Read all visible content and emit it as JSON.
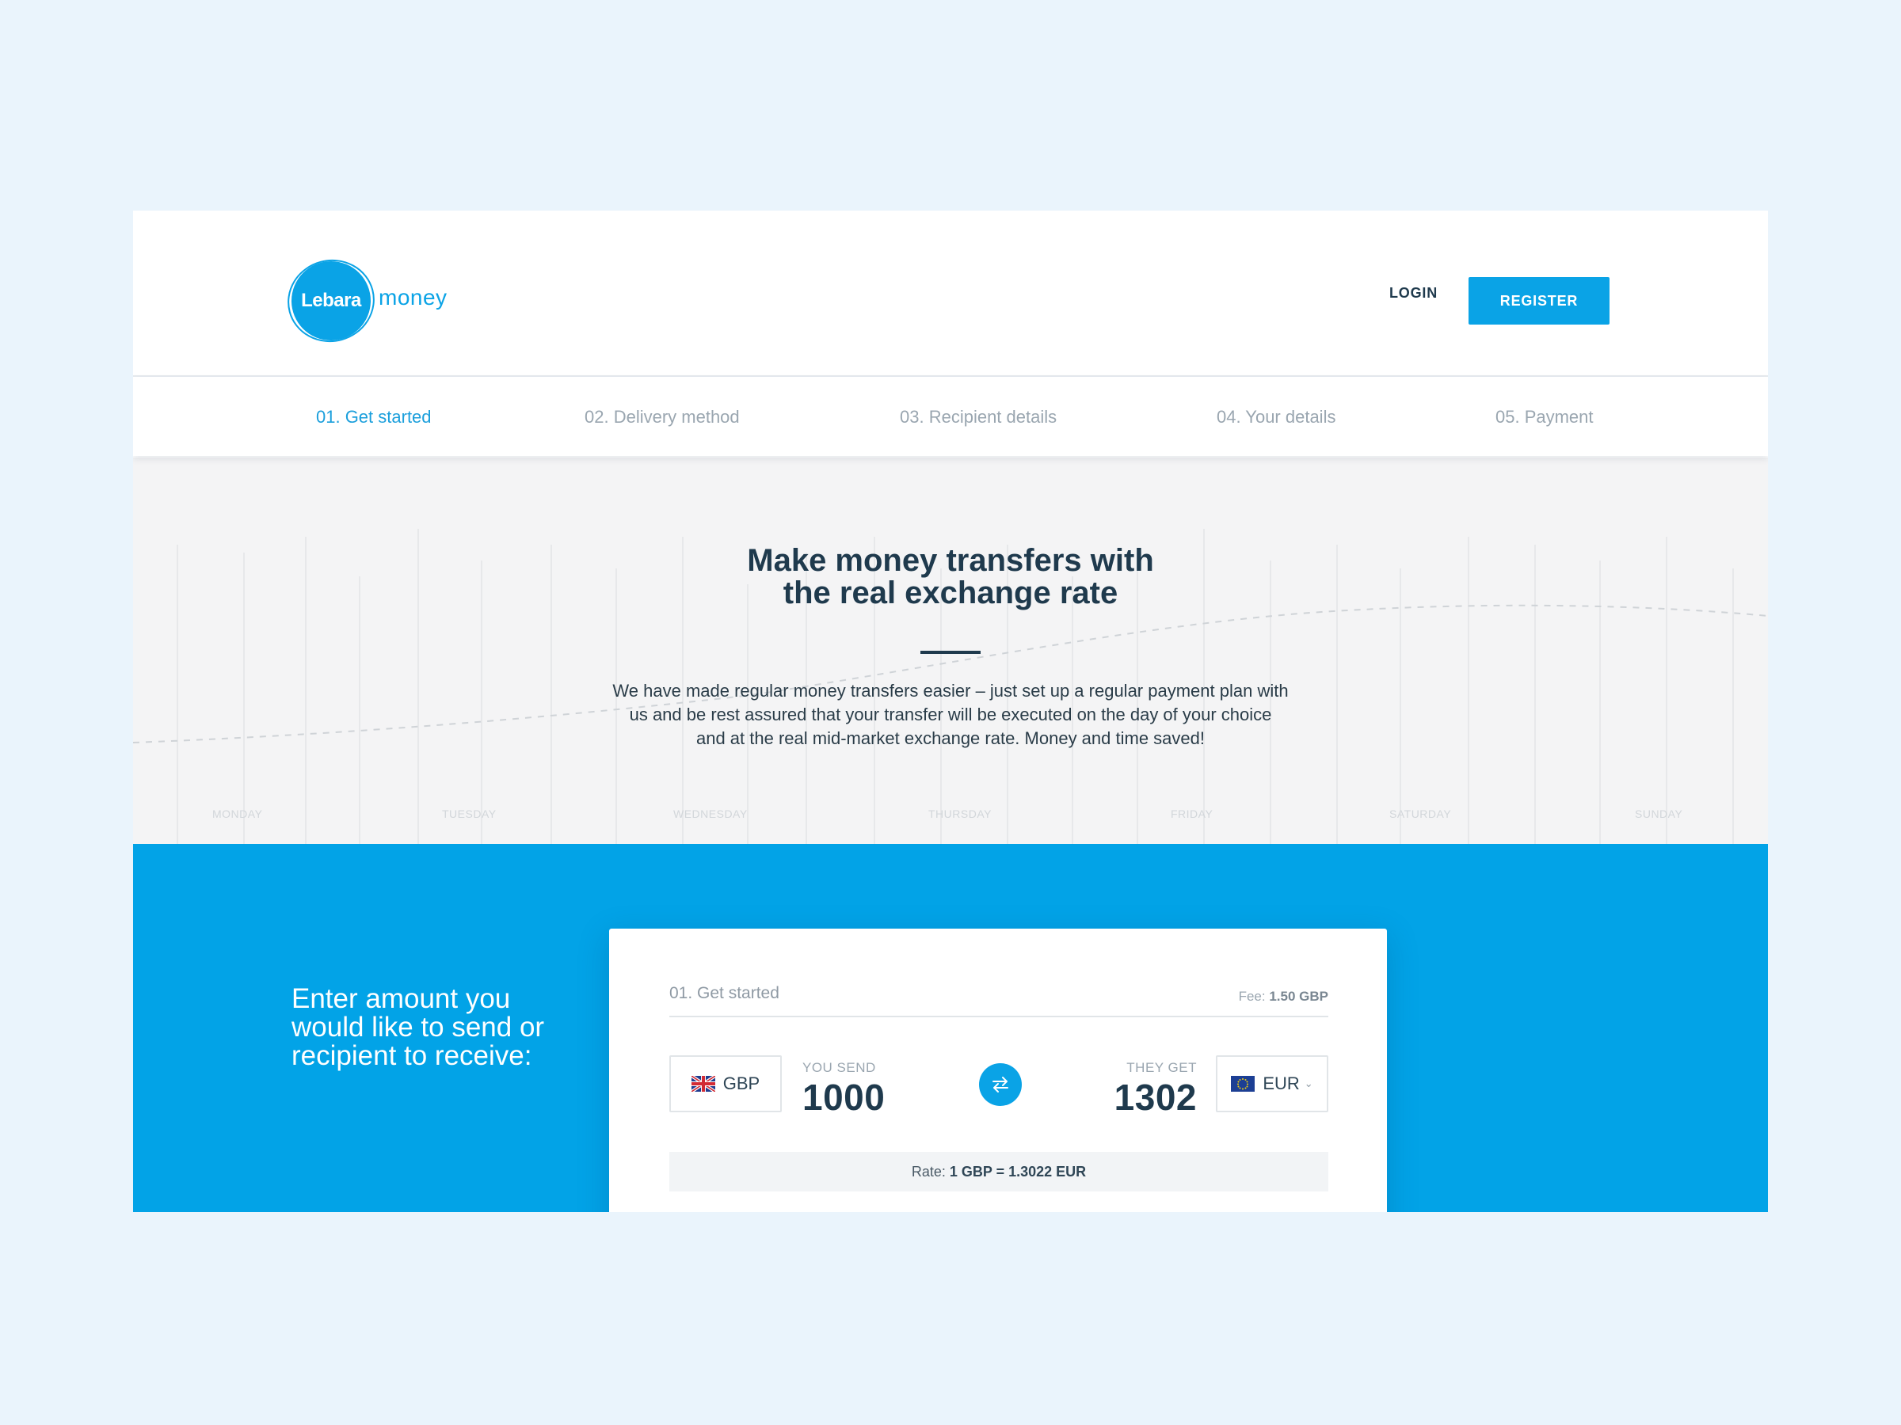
{
  "header": {
    "brand_primary": "Lebara",
    "brand_secondary": "money",
    "login_label": "LOGIN",
    "register_label": "REGISTER"
  },
  "steps": [
    {
      "label": "01. Get started",
      "active": true
    },
    {
      "label": "02. Delivery method",
      "active": false
    },
    {
      "label": "03. Recipient details",
      "active": false
    },
    {
      "label": "04. Your details",
      "active": false
    },
    {
      "label": "05. Payment",
      "active": false
    }
  ],
  "hero": {
    "title_line1": "Make money transfers with",
    "title_line2": "the real exchange rate",
    "text_line1": "We have made regular money transfers easier – just set up a regular payment plan with",
    "text_line2": "us and be rest assured that your transfer will be executed on the day of your choice",
    "text_line3": "and at the real mid-market exchange rate. Money and time saved!",
    "days": [
      "MONDAY",
      "TUESDAY",
      "WEDNESDAY",
      "THURSDAY",
      "FRIDAY",
      "SATURDAY",
      "SUNDAY"
    ]
  },
  "converter": {
    "lead_line1": "Enter amount you",
    "lead_line2": "would like to send or",
    "lead_line3": "recipient to receive:",
    "step_label": "01. Get started",
    "fee_label": "Fee:",
    "fee_value": "1.50 GBP",
    "send_currency": "GBP",
    "send_label": "YOU SEND",
    "send_amount": "1000",
    "get_label": "THEY GET",
    "get_amount": "1302",
    "get_currency": "EUR",
    "rate_label": "Rate:",
    "rate_value": "1 GBP = 1.3022 EUR"
  },
  "colors": {
    "brand_blue": "#0aa3e6",
    "section_blue": "#02a3e7",
    "navy": "#1f3a4d",
    "page_bg": "#eaf4fc"
  },
  "icons": [
    "lebara-logo",
    "uk-flag-icon",
    "eu-flag-icon",
    "swap-arrows-icon",
    "chevron-down-icon"
  ]
}
